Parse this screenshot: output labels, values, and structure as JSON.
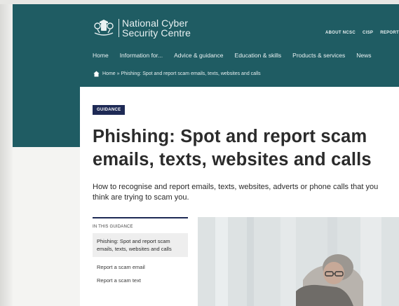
{
  "logo": {
    "line1": "National Cyber",
    "line2": "Security Centre"
  },
  "top_links": [
    "ABOUT NCSC",
    "CISP",
    "REPORT"
  ],
  "main_nav": [
    "Home",
    "Information for...",
    "Advice & guidance",
    "Education & skills",
    "Products & services",
    "News"
  ],
  "breadcrumb": "Home » Phishing: Spot and report scam emails, texts, websites and calls",
  "badge": "GUIDANCE",
  "title": "Phishing: Spot and report scam emails, texts, websites and calls",
  "intro": "How to recognise and report emails, texts, websites, adverts or phone calls that you think are trying to scam you.",
  "toc": {
    "heading": "IN THIS GUIDANCE",
    "current": "Phishing: Spot and report scam emails, texts, websites and calls",
    "links": [
      "Report a scam email",
      "Report a scam text"
    ]
  },
  "colors": {
    "header_bg": "#1f5c63",
    "badge_bg": "#1e2a55",
    "title_text": "#2b2b2b"
  },
  "icons": {
    "crest": "royal-crest-icon",
    "home": "home-icon"
  }
}
